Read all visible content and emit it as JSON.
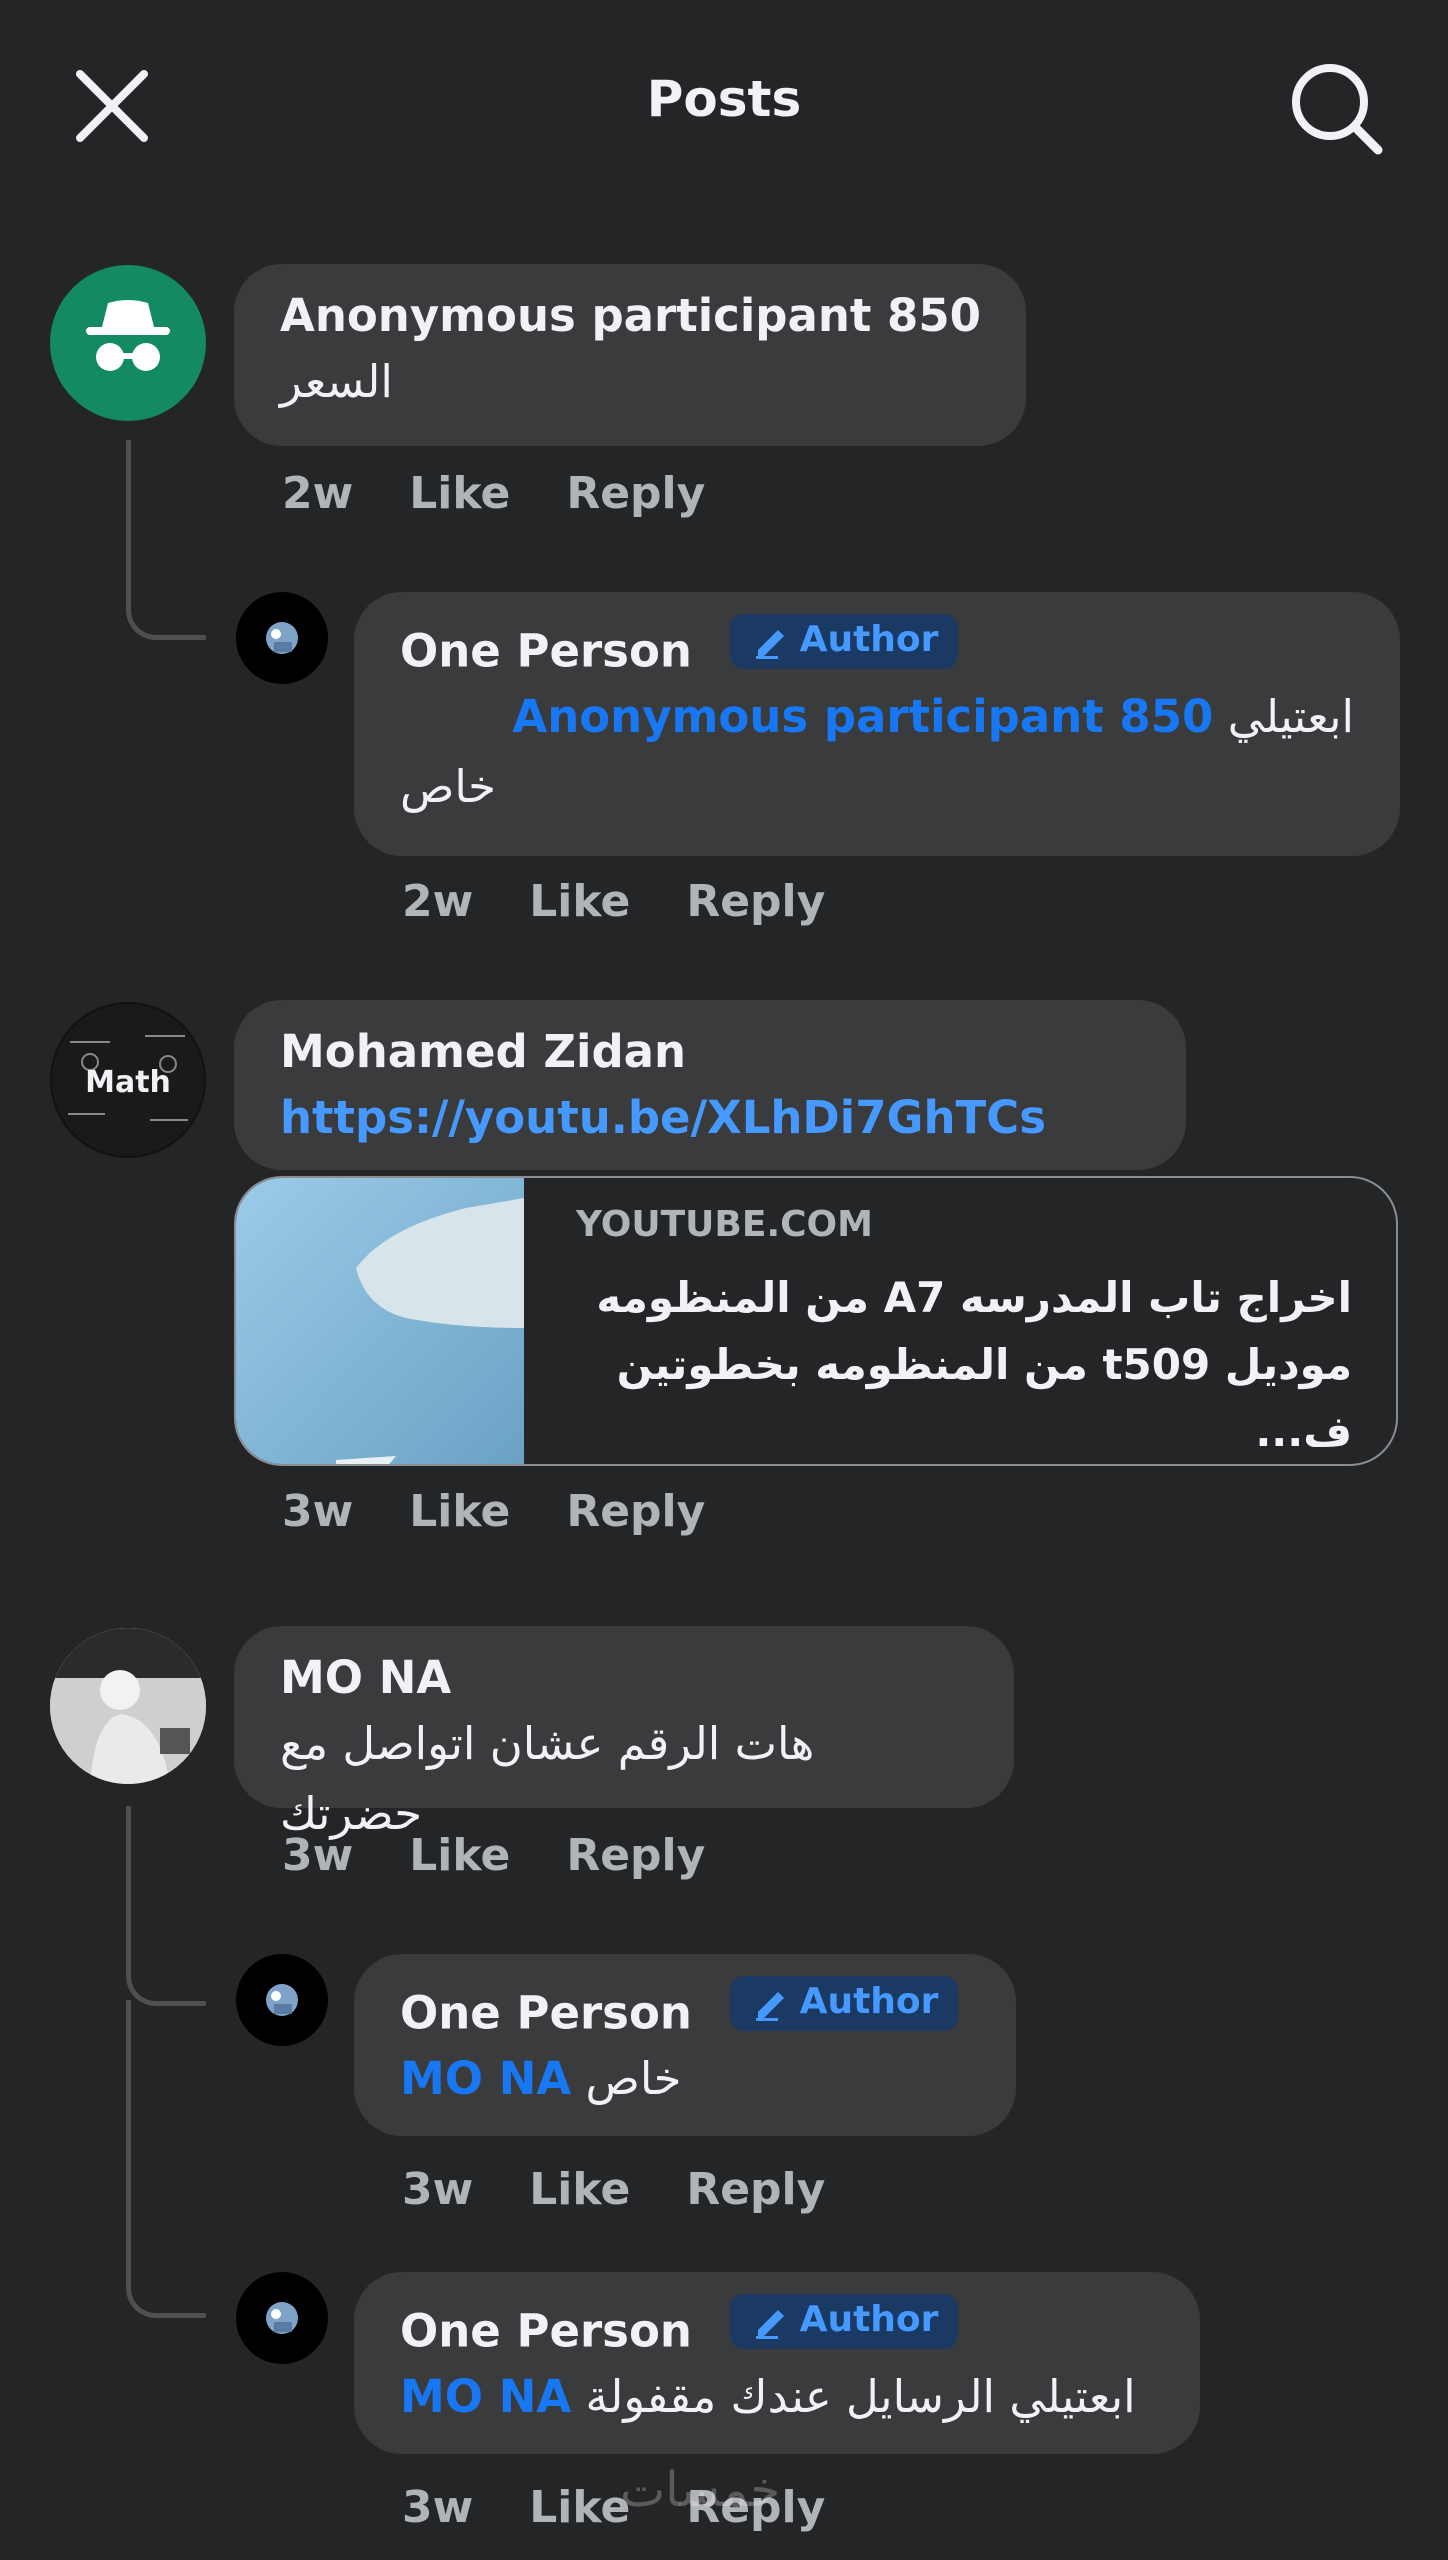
{
  "header": {
    "title": "Posts"
  },
  "comments": [
    {
      "author": "Anonymous participant 850",
      "text": "السعر",
      "time": "2w",
      "like": "Like",
      "reply": "Reply"
    },
    {
      "author": "One Person",
      "badge": "Author",
      "mention": "Anonymous participant 850",
      "text1": "ابعتيلي",
      "text2": "خاص",
      "time": "2w",
      "like": "Like",
      "reply": "Reply"
    },
    {
      "author": "Mohamed Zidan",
      "link": "https://youtu.be/XLhDi7GhTCs",
      "avatar_text": "Math",
      "card": {
        "domain": "YOUTUBE.COM",
        "title_line1": "اخراج تاب المدرسه A7 من المنظومه",
        "title_line2": "موديل t509 من المنظومه بخطوتين ف..."
      },
      "time": "3w",
      "like": "Like",
      "reply": "Reply"
    },
    {
      "author": "MO NA",
      "text": "هات الرقم عشان اتواصل مع حضرتك",
      "time": "3w",
      "like": "Like",
      "reply": "Reply"
    },
    {
      "author": "One Person",
      "badge": "Author",
      "mention": "MO NA",
      "text": "خاص",
      "time": "3w",
      "like": "Like",
      "reply": "Reply"
    },
    {
      "author": "One Person",
      "badge": "Author",
      "mention": "MO NA",
      "text": "ابعتيلي الرسايل عندك مقفولة",
      "time": "3w",
      "like": "Like",
      "reply": "Reply"
    }
  ],
  "watermark": "خمسات",
  "colors": {
    "background": "#242526",
    "bubble": "#3a3b3c",
    "mention": "#1877f2",
    "anon_avatar": "#138a63"
  }
}
